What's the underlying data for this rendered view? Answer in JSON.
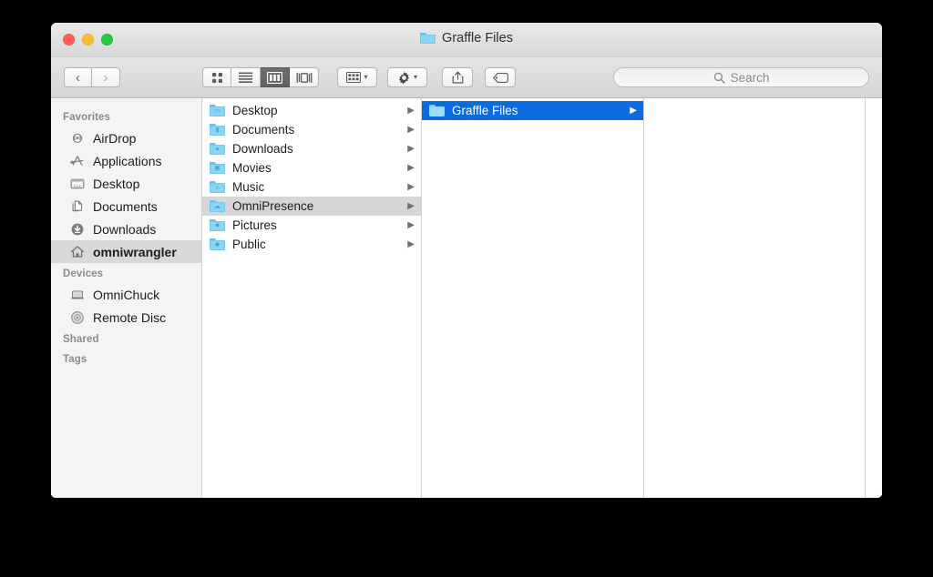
{
  "window": {
    "title": "Graffle Files",
    "title_icon": "folder-icon",
    "traffic_lights": [
      {
        "name": "close-button",
        "color": "#ff5f57"
      },
      {
        "name": "minimize-button",
        "color": "#febc2e"
      },
      {
        "name": "zoom-button",
        "color": "#28c840"
      }
    ]
  },
  "toolbar": {
    "back_label": "‹",
    "forward_label": "›",
    "view_modes": [
      {
        "name": "icon-view",
        "icon": "grid-icon",
        "active": false
      },
      {
        "name": "list-view",
        "icon": "list-icon",
        "active": false
      },
      {
        "name": "column-view",
        "icon": "columns-icon",
        "active": true
      },
      {
        "name": "coverflow-view",
        "icon": "coverflow-icon",
        "active": false
      }
    ],
    "arrange_icon": "arrange-icon",
    "action_icon": "gear-icon",
    "share_icon": "share-icon",
    "tags_icon": "tag-icon",
    "caret": "▾"
  },
  "search": {
    "icon": "search-icon",
    "placeholder": "Search",
    "value": ""
  },
  "sidebar": {
    "sections": [
      {
        "header": "Favorites",
        "items": [
          {
            "label": "AirDrop",
            "icon": "airdrop-icon",
            "selected": false
          },
          {
            "label": "Applications",
            "icon": "applications-icon",
            "selected": false
          },
          {
            "label": "Desktop",
            "icon": "desktop-icon",
            "selected": false
          },
          {
            "label": "Documents",
            "icon": "documents-icon",
            "selected": false
          },
          {
            "label": "Downloads",
            "icon": "downloads-icon",
            "selected": false
          },
          {
            "label": "omniwrangler",
            "icon": "home-icon",
            "selected": true
          }
        ]
      },
      {
        "header": "Devices",
        "items": [
          {
            "label": "OmniChuck",
            "icon": "laptop-icon",
            "selected": false
          },
          {
            "label": "Remote Disc",
            "icon": "disc-icon",
            "selected": false
          }
        ]
      },
      {
        "header": "Shared",
        "items": []
      },
      {
        "header": "Tags",
        "items": []
      }
    ]
  },
  "columns": [
    {
      "name": "column-home",
      "rows": [
        {
          "label": "Desktop",
          "icon": "folder-desktop-icon",
          "glyph": "▭",
          "selection": "none"
        },
        {
          "label": "Documents",
          "icon": "folder-documents-icon",
          "glyph": "▮",
          "selection": "none"
        },
        {
          "label": "Downloads",
          "icon": "folder-downloads-icon",
          "glyph": "●",
          "selection": "none"
        },
        {
          "label": "Movies",
          "icon": "folder-movies-icon",
          "glyph": "▣",
          "selection": "none"
        },
        {
          "label": "Music",
          "icon": "folder-music-icon",
          "glyph": "♪",
          "selection": "none"
        },
        {
          "label": "OmniPresence",
          "icon": "folder-omnipresence-icon",
          "glyph": "☁",
          "selection": "inactive"
        },
        {
          "label": "Pictures",
          "icon": "folder-pictures-icon",
          "glyph": "■",
          "selection": "none"
        },
        {
          "label": "Public",
          "icon": "folder-public-icon",
          "glyph": "◆",
          "selection": "none"
        }
      ]
    },
    {
      "name": "column-omnipresence",
      "rows": [
        {
          "label": "Graffle Files",
          "icon": "folder-icon",
          "glyph": "",
          "selection": "active"
        }
      ]
    },
    {
      "name": "column-graffle-files",
      "rows": []
    },
    {
      "name": "column-empty",
      "rows": []
    }
  ],
  "colors": {
    "selection_active": "#0b6bdf",
    "selection_inactive": "#d6d6d6",
    "sidebar_background": "#f4f4f4",
    "folder_blue": "#8ad5f5",
    "desktop_background": "#000000"
  }
}
